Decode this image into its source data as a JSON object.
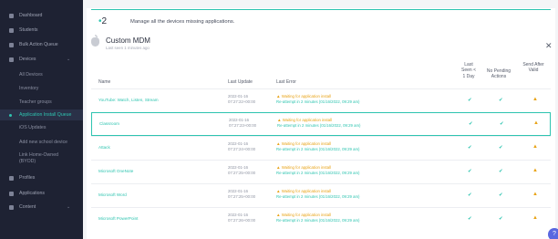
{
  "sidebar": {
    "items": [
      {
        "label": "Dashboard",
        "icon": "dashboard-icon"
      },
      {
        "label": "Students",
        "icon": "students-icon"
      },
      {
        "label": "Bulk Action Queue",
        "icon": "queue-icon"
      },
      {
        "label": "Devices",
        "icon": "devices-icon"
      },
      {
        "label": "All Devices"
      },
      {
        "label": "Inventory"
      },
      {
        "label": "Teacher groups"
      },
      {
        "label": "Application Install Queue"
      },
      {
        "label": "iOS Updates"
      },
      {
        "label": "Add new school device"
      },
      {
        "label": "Link Home-Owned (BYOD)"
      },
      {
        "label": "Profiles",
        "icon": "profiles-icon"
      },
      {
        "label": "Applications",
        "icon": "applications-icon"
      },
      {
        "label": "Content",
        "icon": "content-icon"
      }
    ]
  },
  "banner": {
    "count": "2",
    "text": "Manage all the devices missing applications."
  },
  "header": {
    "title": "Custom MDM",
    "subtitle": "Last seen 1 minutes ago"
  },
  "columns": {
    "name": "Name",
    "last_update": "Last Update",
    "last_error": "Last Error",
    "last_seen": "Last Seen < 1 Day",
    "no_pending": "No Pending Actions",
    "send_after": "Send After Valid"
  },
  "rows": [
    {
      "name": "YouTube: Watch, Listen, Stream",
      "date": "2022-01-16",
      "time": "07:27:22+00:00",
      "error": "Waiting for application install",
      "retry": "Re-attempt in 2 minutes (01/16/2022, 09:29 am)"
    },
    {
      "name": "Classroom",
      "date": "2022-01-16",
      "time": "07:27:23+00:00",
      "error": "Waiting for application install",
      "retry": "Re-attempt in 2 minutes (01/16/2022, 09:29 am)"
    },
    {
      "name": "Attack",
      "date": "2022-01-16",
      "time": "07:27:24+00:00",
      "error": "Waiting for application install",
      "retry": "Re-attempt in 2 minutes (01/16/2022, 09:29 am)"
    },
    {
      "name": "Microsoft OneNote",
      "date": "2022-01-16",
      "time": "07:27:25+00:00",
      "error": "Waiting for application install",
      "retry": "Re-attempt in 2 minutes (01/16/2022, 09:29 am)"
    },
    {
      "name": "Microsoft Word",
      "date": "2022-01-16",
      "time": "07:27:25+00:00",
      "error": "Waiting for application install",
      "retry": "Re-attempt in 2 minutes (01/16/2022, 09:29 am)"
    },
    {
      "name": "Microsoft PowerPoint",
      "date": "2022-01-16",
      "time": "07:27:26+00:00",
      "error": "Waiting for application install",
      "retry": "Re-attempt in 2 minutes (01/16/2022, 09:29 am)"
    }
  ],
  "status_glyphs": {
    "check": "✔",
    "warning": "▲"
  },
  "colors": {
    "accent": "#2ec4b0",
    "warning": "#e8a317",
    "sidebar_bg": "#1e2233",
    "help": "#5a67e0"
  }
}
